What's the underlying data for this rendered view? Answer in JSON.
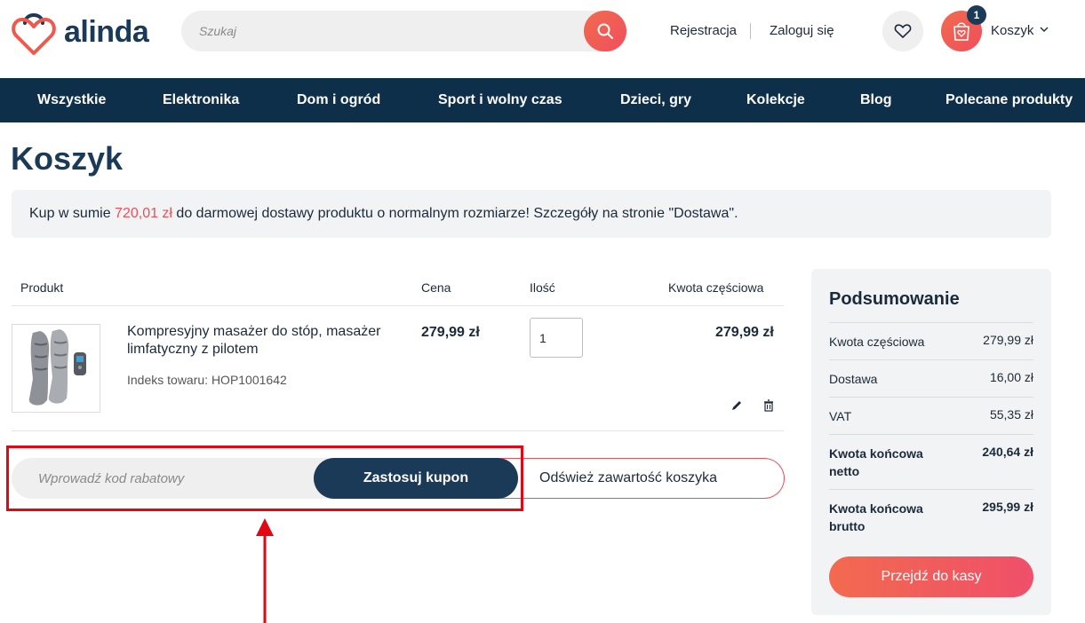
{
  "header": {
    "logo_text": "alinda",
    "search_placeholder": "Szukaj",
    "register_link": "Rejestracja",
    "login_link": "Zaloguj się",
    "cart_label": "Koszyk",
    "cart_count": "1"
  },
  "nav": {
    "items": [
      "Wszystkie",
      "Elektronika",
      "Dom i ogród",
      "Sport i wolny czas",
      "Dzieci, gry",
      "Kolekcje",
      "Blog",
      "Polecane produkty"
    ]
  },
  "page": {
    "title": "Koszyk",
    "notice_prefix": "Kup w sumie ",
    "notice_amount": "720,01 zł",
    "notice_suffix": " do darmowej dostawy produktu o normalnym rozmiarze! Szczegóły na stronie \"Dostawa\"."
  },
  "table": {
    "headers": {
      "product": "Produkt",
      "price": "Cena",
      "qty": "Ilość",
      "subtotal": "Kwota częściowa"
    },
    "rows": [
      {
        "name": "Kompresyjny masażer do stóp, masażer limfatyczny z pilotem",
        "sku": "Indeks towaru: HOP1001642",
        "price": "279,99 zł",
        "qty": "1",
        "subtotal": "279,99 zł"
      }
    ]
  },
  "coupon": {
    "placeholder": "Wprowadź kod rabatowy",
    "apply_label": "Zastosuj kupon",
    "refresh_label": "Odśwież zawartość koszyka"
  },
  "summary": {
    "title": "Podsumowanie",
    "lines": [
      {
        "label": "Kwota częściowa",
        "value": "279,99 zł"
      },
      {
        "label": "Dostawa",
        "value": "16,00 zł"
      },
      {
        "label": "VAT",
        "value": "55,35 zł"
      },
      {
        "label": "Kwota końcowa netto",
        "value": "240,64 zł"
      },
      {
        "label": "Kwota końcowa brutto",
        "value": "295,99 zł"
      }
    ],
    "checkout_label": "Przejdź do kasy"
  },
  "colors": {
    "accent": "#ef4f5c",
    "navy": "#0e2f4a",
    "highlight": "#e30613"
  },
  "icons": [
    "heart-logo-icon",
    "search-icon",
    "heart-icon",
    "shopping-bag-icon",
    "chevron-down-icon",
    "pencil-icon",
    "trash-icon",
    "up-arrow-icon"
  ]
}
